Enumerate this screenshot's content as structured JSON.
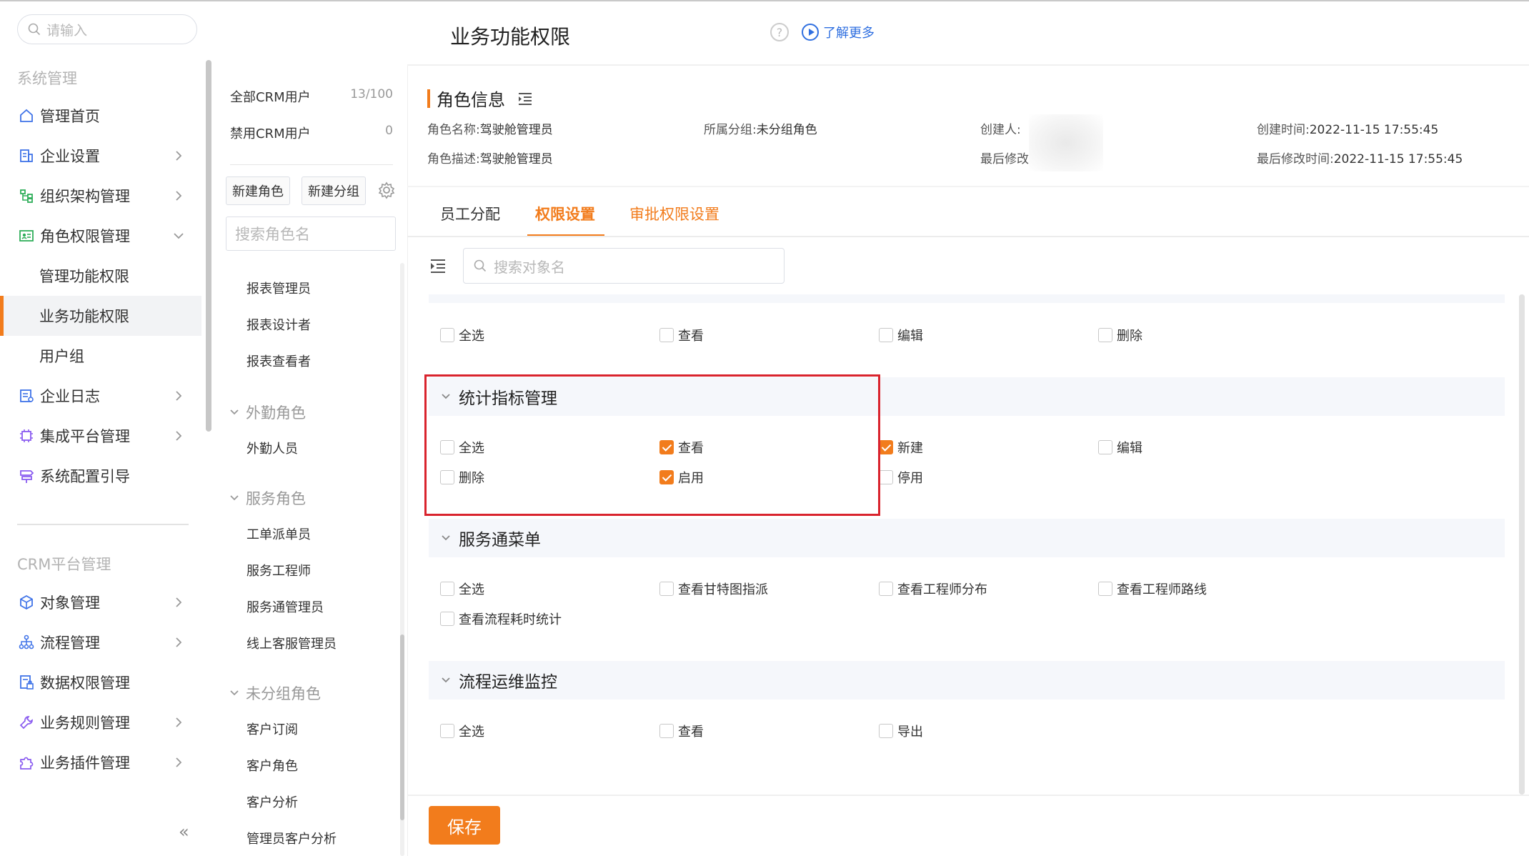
{
  "nav": {
    "search_placeholder": "请输入",
    "group1": "系统管理",
    "items": [
      {
        "label": "管理首页"
      },
      {
        "label": "企业设置"
      },
      {
        "label": "组织架构管理"
      },
      {
        "label": "角色权限管理"
      },
      {
        "label": "管理功能权限"
      },
      {
        "label": "业务功能权限"
      },
      {
        "label": "用户组"
      },
      {
        "label": "企业日志"
      },
      {
        "label": "集成平台管理"
      },
      {
        "label": "系统配置引导"
      }
    ],
    "group2": "CRM平台管理",
    "items2": [
      {
        "label": "对象管理"
      },
      {
        "label": "流程管理"
      },
      {
        "label": "数据权限管理"
      },
      {
        "label": "业务规则管理"
      },
      {
        "label": "业务插件管理"
      }
    ],
    "collapse": "«"
  },
  "roles": {
    "all_users": "全部CRM用户",
    "all_users_count": "13/100",
    "disabled_users": "禁用CRM用户",
    "disabled_users_count": "0",
    "new_role": "新建角色",
    "new_group": "新建分组",
    "search_placeholder": "搜索角色名",
    "top_items": [
      "报表管理员",
      "报表设计者",
      "报表查看者"
    ],
    "groups": [
      {
        "name": "外勤角色",
        "items": [
          "外勤人员"
        ]
      },
      {
        "name": "服务角色",
        "items": [
          "工单派单员",
          "服务工程师",
          "服务通管理员",
          "线上客服管理员"
        ]
      },
      {
        "name": "未分组角色",
        "items": [
          "客户订阅",
          "客户角色",
          "客户分析",
          "管理员客户分析"
        ]
      }
    ]
  },
  "header": {
    "title": "业务功能权限",
    "help": "?",
    "learn_more": "了解更多"
  },
  "role_info": {
    "title": "角色信息",
    "name_label": "角色名称:",
    "name_value": "驾驶舱管理员",
    "group_label": "所属分组:",
    "group_value": "未分组角色",
    "creator_label": "创建人:",
    "created_label": "创建时间:",
    "created_value": "2022-11-15 17:55:45",
    "desc_label": "角色描述:",
    "desc_value": "驾驶舱管理员",
    "modifier_label": "最后修改",
    "modified_label": "最后修改时间:",
    "modified_value": "2022-11-15 17:55:45"
  },
  "tabs": [
    "员工分配",
    "权限设置",
    "审批权限设置"
  ],
  "active_tab": "权限设置",
  "object_search_placeholder": "搜索对象名",
  "permissions": {
    "top_row": [
      {
        "label": "全选",
        "checked": false
      },
      {
        "label": "查看",
        "checked": false
      },
      {
        "label": "编辑",
        "checked": false
      },
      {
        "label": "删除",
        "checked": false
      }
    ],
    "sections": [
      {
        "title": "统计指标管理",
        "options": [
          {
            "label": "全选",
            "checked": false
          },
          {
            "label": "查看",
            "checked": true
          },
          {
            "label": "新建",
            "checked": true
          },
          {
            "label": "编辑",
            "checked": false
          },
          {
            "label": "删除",
            "checked": false
          },
          {
            "label": "启用",
            "checked": true
          },
          {
            "label": "停用",
            "checked": false
          }
        ]
      },
      {
        "title": "服务通菜单",
        "options": [
          {
            "label": "全选",
            "checked": false
          },
          {
            "label": "查看甘特图指派",
            "checked": false
          },
          {
            "label": "查看工程师分布",
            "checked": false
          },
          {
            "label": "查看工程师路线",
            "checked": false
          },
          {
            "label": "查看流程耗时统计",
            "checked": false
          }
        ]
      },
      {
        "title": "流程运维监控",
        "options": [
          {
            "label": "全选",
            "checked": false
          },
          {
            "label": "查看",
            "checked": false
          },
          {
            "label": "导出",
            "checked": false
          }
        ]
      }
    ]
  },
  "save_label": "保存",
  "accent_color": "#f27c1c",
  "highlight_color": "#d9232d"
}
